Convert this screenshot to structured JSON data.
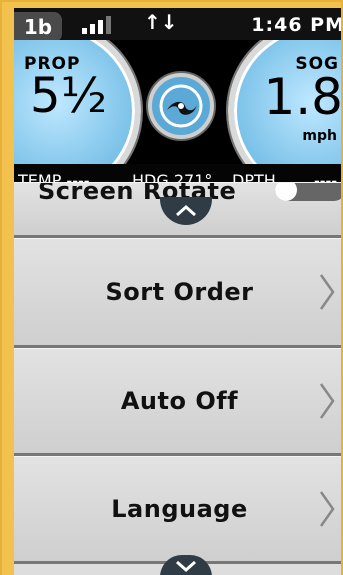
{
  "status_bar": {
    "app_badge": "1b",
    "signal_icon": "signal-bars-icon",
    "data_icon": "data-transfer-icon",
    "time": "1:46 PM"
  },
  "gauges": {
    "prop": {
      "title": "PROP",
      "value": "5½"
    },
    "sog": {
      "title": "SOG",
      "value": "1.8",
      "unit": "mph"
    },
    "center_icon": "propeller-icon",
    "colors": {
      "gauge_face": "#7fc4ea",
      "bezel": "#d9d9d9"
    }
  },
  "info_strip": {
    "temp": "TEMP ----",
    "heading": "HDG 271°",
    "depth_label": "DPTH",
    "depth_value": "----"
  },
  "menu": {
    "partial_item": "Screen Rotate",
    "items": [
      {
        "label": "Sort Order"
      },
      {
        "label": "Auto Off"
      },
      {
        "label": "Language"
      }
    ]
  }
}
